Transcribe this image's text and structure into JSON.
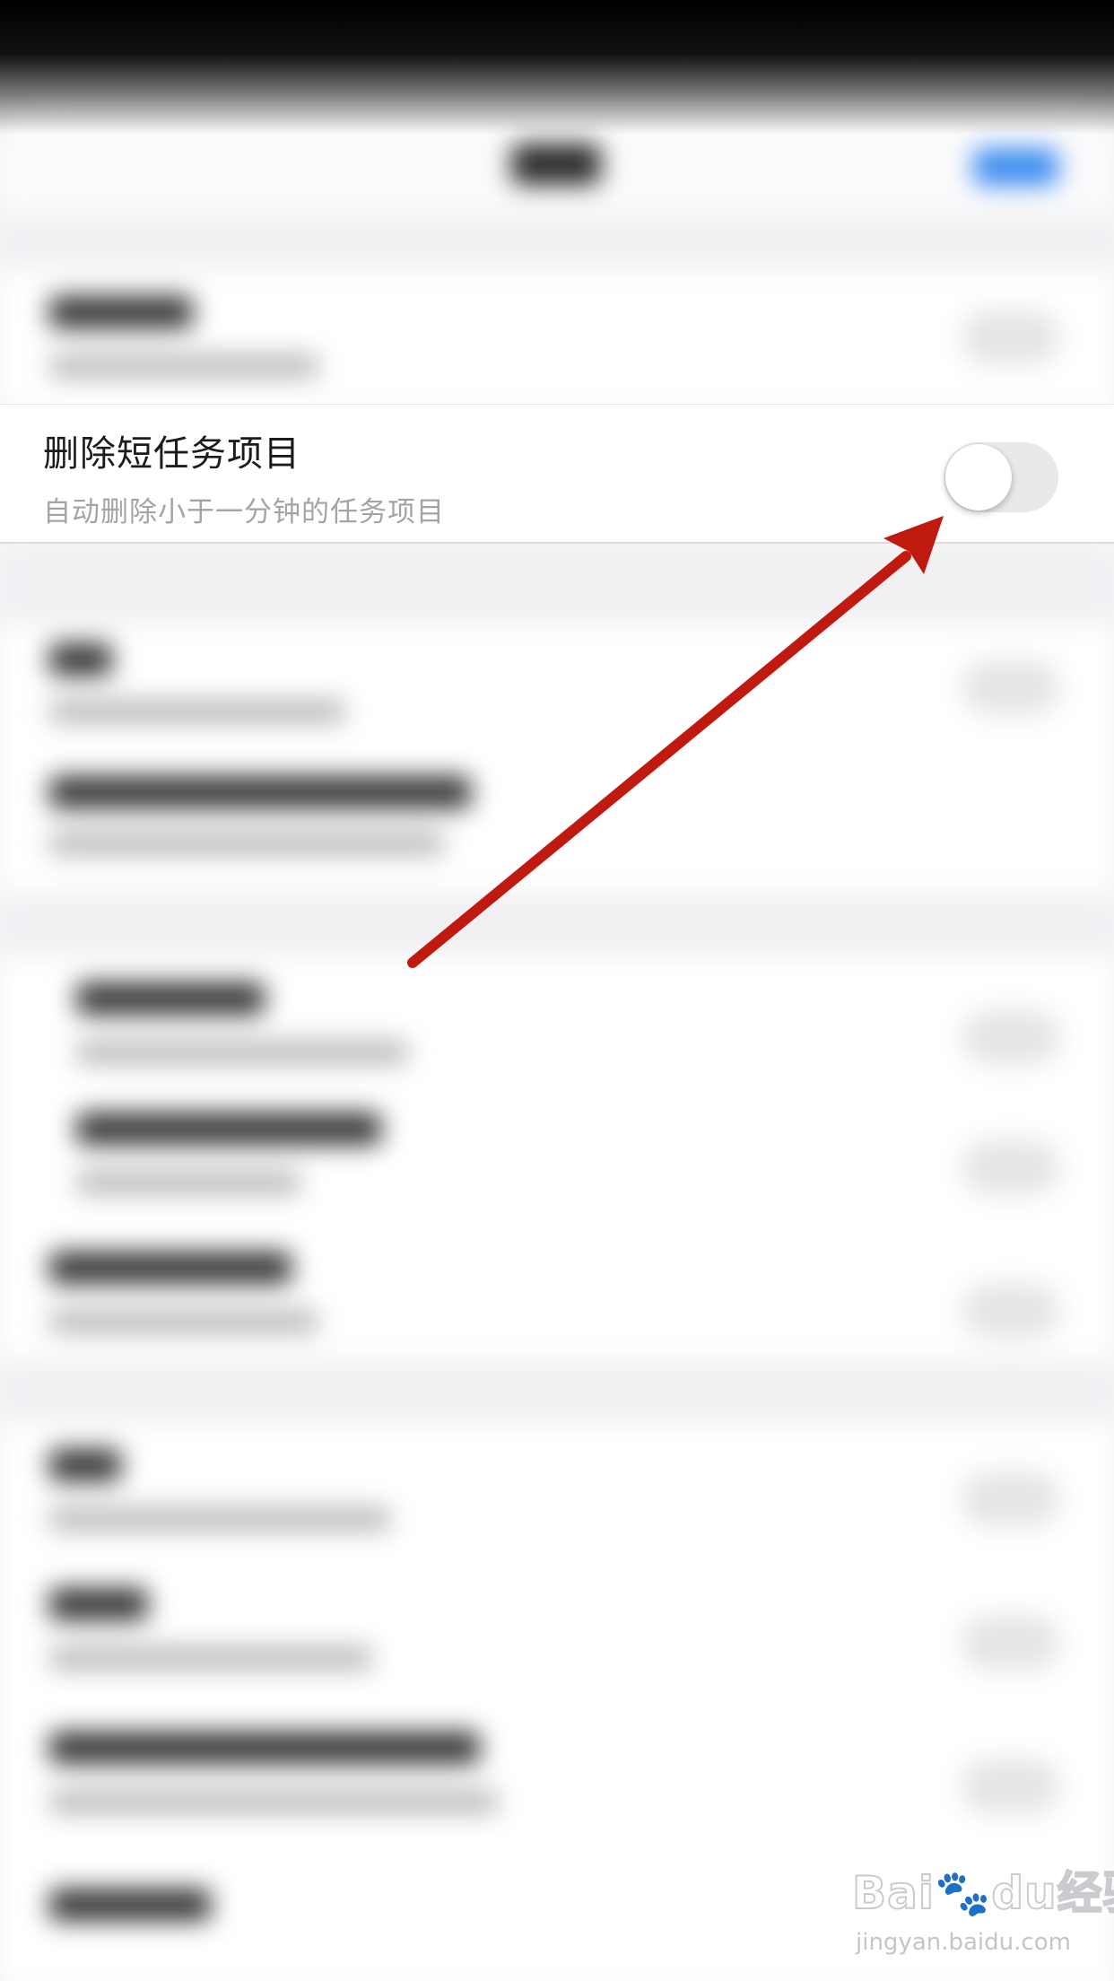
{
  "setting_row": {
    "title": "删除短任务项目",
    "subtitle": "自动删除小于一分钟的任务项目",
    "toggle_on": false
  },
  "annotation": {
    "arrow_color": "#c0190f"
  },
  "watermark": {
    "logo": "Bai🐾du经验",
    "url": "jingyan.baidu.com"
  },
  "colors": {
    "toggle_off_track": "#e9e9ec",
    "title_text": "#1c1c1e",
    "subtitle_text": "#a4a4a8"
  }
}
